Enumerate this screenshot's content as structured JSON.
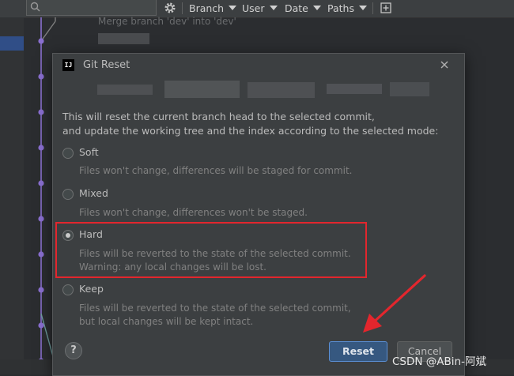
{
  "toolbar": {
    "filters": [
      "Branch",
      "User",
      "Date",
      "Paths"
    ]
  },
  "background_log": {
    "commit_message": "Merge branch 'dev' into 'dev'"
  },
  "dialog": {
    "title": "Git Reset",
    "app_icon_text": "IJ",
    "description_line1": "This will reset the current branch head to the selected commit,",
    "description_line2": "and update the working tree and the index according to the selected mode:",
    "options": [
      {
        "label": "Soft",
        "desc1": "Files won't change, differences will be staged for commit.",
        "desc2": "",
        "checked": false
      },
      {
        "label": "Mixed",
        "desc1": "Files won't change, differences won't be staged.",
        "desc2": "",
        "checked": false
      },
      {
        "label": "Hard",
        "desc1": "Files will be reverted to the state of the selected commit.",
        "desc2": "Warning: any local changes will be lost.",
        "checked": true
      },
      {
        "label": "Keep",
        "desc1": "Files will be reverted to the state of the selected commit,",
        "desc2": "but local changes will be kept intact.",
        "checked": false
      }
    ],
    "help_label": "?",
    "reset_label": "Reset",
    "cancel_label": "Cancel"
  },
  "annotation": {
    "highlight_color": "#e3262d",
    "arrow_color": "#e3262d"
  },
  "watermark": "CSDN @ABin-阿斌"
}
